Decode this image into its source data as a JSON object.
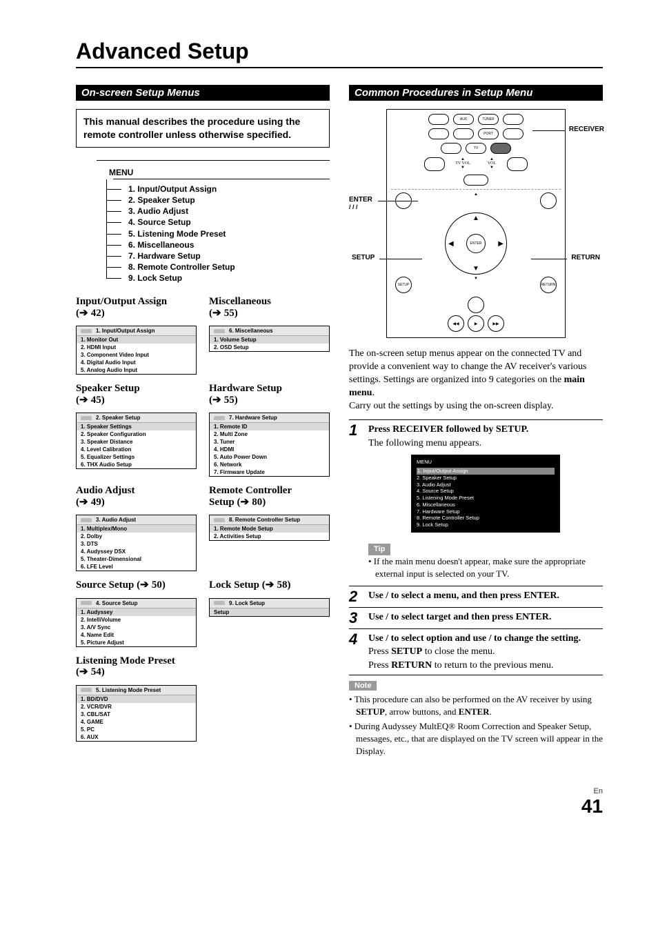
{
  "title": "Advanced Setup",
  "left": {
    "section_title": "On-screen Setup Menus",
    "intro": "This manual describes the procedure using the remote controller unless otherwise specified.",
    "menu_label": "MENU",
    "menu_items": [
      "1. Input/Output Assign",
      "2. Speaker Setup",
      "3. Audio Adjust",
      "4. Source Setup",
      "5. Listening Mode Preset",
      "6. Miscellaneous",
      "7. Hardware Setup",
      "8. Remote Controller Setup",
      "9. Lock Setup"
    ],
    "blocks": [
      {
        "title": "Input/Output Assign",
        "page": "42",
        "box_head": "1.   Input/Output Assign",
        "items": [
          "1.   Monitor Out",
          "2.   HDMI Input",
          "3.   Component Video Input",
          "4.   Digital Audio Input",
          "5.   Analog Audio Input"
        ]
      },
      {
        "title": "Speaker Setup",
        "page": "45",
        "box_head": "2.   Speaker Setup",
        "items": [
          "1.   Speaker Settings",
          "2.   Speaker Configuration",
          "3.   Speaker Distance",
          "4.   Level Calibration",
          "5.   Equalizer Settings",
          "6.   THX Audio Setup"
        ]
      },
      {
        "title": "Audio Adjust",
        "page": "49",
        "box_head": "3.   Audio Adjust",
        "items": [
          "1.   Multiplex/Mono",
          "2.   Dolby",
          "3.   DTS",
          "4.   Audyssey DSX",
          "5.   Theater-Dimensional",
          "6.   LFE Level"
        ]
      },
      {
        "title": "Source Setup",
        "page": "50",
        "box_head": "4.   Source Setup",
        "items": [
          "1.   Audyssey",
          "2.   IntelliVolume",
          "3.   A/V Sync",
          "4.   Name Edit",
          "5.   Picture Adjust"
        ]
      },
      {
        "title": "Miscellaneous",
        "page": "55",
        "box_head": "6.   Miscellaneous",
        "items": [
          "1.   Volume Setup",
          "2.   OSD Setup"
        ]
      },
      {
        "title": "Hardware Setup",
        "page": "55",
        "box_head": "7.   Hardware Setup",
        "items": [
          "1.   Remote ID",
          "2.   Multi Zone",
          "3.   Tuner",
          "4.   HDMI",
          "5.   Auto Power Down",
          "6.   Network",
          "7.   Firmware Update"
        ]
      },
      {
        "title_l1": "Remote Controller",
        "title_l2": "Setup",
        "page": "80",
        "box_head": "8.   Remote Controller Setup",
        "items": [
          "1.   Remote Mode Setup",
          "2.   Activities Setup"
        ]
      },
      {
        "title": "Lock Setup",
        "page": "58",
        "box_head": "9.   Lock Setup",
        "items": [
          "Setup"
        ]
      },
      {
        "title": "Listening Mode Preset",
        "page": "54",
        "box_head": "5.   Listening Mode Preset",
        "items": [
          "1.   BD/DVD",
          "2.   VCR/DVR",
          "3.   CBL/SAT",
          "4.   GAME",
          "5.   PC",
          "6.   AUX"
        ]
      }
    ]
  },
  "right": {
    "section_title": "Common Procedures in Setup Menu",
    "labels": {
      "receiver": "RECEIVER",
      "enter": "ENTER",
      "arrows": "/ / /",
      "setup": "SETUP",
      "return": "RETURN"
    },
    "intro_1": "The on-screen setup menus appear on the connected TV and provide a convenient way to change the AV receiver's various settings. Settings are organized into 9 categories on the",
    "intro_bold": "main menu",
    "intro_1b": ".",
    "intro_2": "Carry out the settings by using the on-screen display.",
    "steps": [
      {
        "n": "1",
        "l1a": "Press",
        "l1b": "RECEIVER",
        "l1c": "followed by",
        "l1d": "SETUP",
        "l1e": ".",
        "l2": "The following menu appears."
      },
      {
        "n": "2",
        "a": "Use",
        "b": "to select a menu, and then press",
        "c": "ENTER",
        "d": "."
      },
      {
        "n": "3",
        "a": "Use",
        "b": "to select target and then press",
        "c": "ENTER",
        "d": "."
      },
      {
        "n": "4",
        "a": "Use",
        "b": "to select option and use",
        "c": "to change the setting.",
        "l2a": "Press",
        "l2b": "SETUP",
        "l2c": "to close the menu.",
        "l3a": "Press",
        "l3b": "RETURN",
        "l3c": "to return to the previous menu."
      }
    ],
    "mini": {
      "title": "MENU",
      "items": [
        "1. Input/Output Assign",
        "2. Speaker Setup",
        "3. Audio Adjust",
        "4. Source Setup",
        "5. Listening Mode Preset",
        "6. Miscellaneous",
        "7. Hardware Setup",
        "8. Remote Controller Setup",
        "9. Lock Setup"
      ]
    },
    "tip_label": "Tip",
    "tip_text": "• If the main menu doesn't appear, make sure the appropriate external input is selected on your TV.",
    "note_label": "Note",
    "notes": [
      {
        "a": "• This procedure can also be performed on the AV receiver by using",
        "b": "SETUP",
        "c": ", arrow buttons, and",
        "d": "ENTER",
        "e": "."
      },
      "• During Audyssey MultEQ® Room Correction and Speaker Setup, messages, etc., that are displayed on the TV screen will appear in the Display."
    ]
  },
  "footer": {
    "lang": "En",
    "page": "41"
  }
}
